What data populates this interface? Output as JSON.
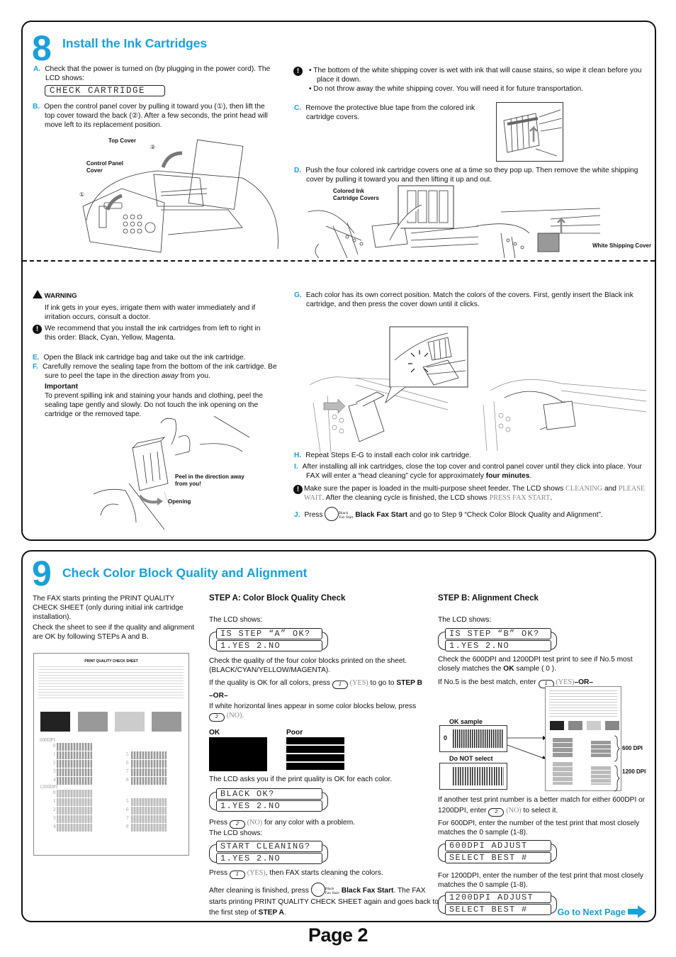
{
  "step8": {
    "number": "8",
    "title": "Install the Ink Cartridges",
    "a": {
      "letter": "A.",
      "text": "Check that the power is turned on (by plugging in the power cord). The LCD shows:",
      "lcd": "CHECK CARTRIDGE"
    },
    "b": {
      "letter": "B.",
      "text": "Open the control panel cover by pulling it toward you (①), then lift the top cover toward the back (②). After a few seconds, the print head will move left to its replacement position."
    },
    "fig_b_labels": {
      "top_cover": "Top Cover",
      "control_panel_cover": "Control Panel Cover",
      "marker1": "①",
      "marker2": "②"
    },
    "note_top": {
      "bullets": [
        "The bottom of the white shipping cover is wet with ink that will cause stains, so wipe it clean before you place it down.",
        "Do not throw away the white shipping cover. You will need it for future transportation."
      ]
    },
    "c": {
      "letter": "C.",
      "text": "Remove the protective blue tape from the colored ink cartridge covers."
    },
    "d": {
      "letter": "D.",
      "text": "Push the four colored ink cartridge covers one at a time so they pop up. Then remove the white shipping cover by pulling it toward you and then lifting it up and out."
    },
    "fig_d_labels": {
      "colored_covers": "Colored Ink Cartridge Covers",
      "white_cover": "White Shipping Cover"
    },
    "warning": {
      "title": "WARNING",
      "text": "If ink gets in your eyes, irrigate them with water immediately and if irritation occurs, consult a doctor."
    },
    "note_order": "We recommend that you install the ink cartridges from left to right in this order: Black, Cyan, Yellow, Magenta.",
    "e": {
      "letter": "E.",
      "text": "Open the Black ink cartridge bag and take out the ink cartridge."
    },
    "f": {
      "letter": "F.",
      "text_before": "Carefully remove the sealing tape from the bottom of the ink cartridge. Be sure to peel the tape in the direction ",
      "text_em": "away",
      "text_after": " from you."
    },
    "important": {
      "title": "Important",
      "text": "To prevent spilling ink and staining your hands and clothing, peel the sealing tape gently and slowly. Do not touch the ink opening on the cartridge or the removed tape."
    },
    "fig_f_labels": {
      "peel": "Peel in the direction away from you!",
      "opening": "Opening"
    },
    "g": {
      "letter": "G.",
      "text": "Each color has its own correct position. Match the colors of the covers. First, gently insert the Black ink cartridge, and then press the cover down until it clicks."
    },
    "h": {
      "letter": "H.",
      "text": "Repeat Steps E-G to install each color ink cartridge."
    },
    "i": {
      "letter": "I.",
      "text_before": "After installing all ink cartridges, close the top cover and control panel cover until they click into place. Your FAX will enter a “head cleaning” cycle for approximately ",
      "text_bold": "four minutes",
      "text_after": "."
    },
    "note_paper": {
      "t1": "Make sure the paper is loaded in the multi-purpose sheet feeder. The LCD shows ",
      "lcd1": "CLEANING",
      "t2": " and ",
      "lcd2": "PLEASE WAIT",
      "t3": ". After the cleaning cycle is finished, the LCD shows ",
      "lcd3": "PRESS FAX START",
      "t4": "."
    },
    "j": {
      "letter": "J.",
      "press": "Press",
      "key_label": "Black Fax Start",
      "bold": "Black Fax Start",
      "after": " and go to Step 9 “Check Color Block Quality and Alignment”."
    }
  },
  "step9": {
    "number": "9",
    "title": "Check Color Block Quality and Alignment",
    "intro1": "The FAX starts printing the PRINT QUALITY CHECK SHEET (only during initial ink cartridge installation).",
    "intro2": "Check the sheet to see if the quality and alignment are OK by following STEPs A and B.",
    "sheet": {
      "title": "PRINT QUALITY CHECK SHEET",
      "dpi600": "600DPI",
      "dpi1200": "1200DPI",
      "left_nums": [
        "0",
        "1",
        "2",
        "3",
        "4"
      ],
      "right_nums": [
        "5",
        "6",
        "7",
        "8"
      ]
    },
    "step_a": {
      "heading": "STEP A: Color Block Quality Check",
      "lcd_shows": "The LCD shows:",
      "lcd1": [
        "IS STEP “A” OK?",
        "1.YES 2.NO"
      ],
      "check_text": "Check the quality of the four color blocks printed on the sheet. (BLACK/CYAN/YELLOW/MAGENTA).",
      "if_ok_before": "If the quality is OK for all colors, press ",
      "key1": "1",
      "yes": "(YES)",
      "if_ok_after": " to go to ",
      "step_b_ref": "STEP B",
      "or": "–OR–",
      "if_lines": "If white horizontal lines appear in some color blocks below, press",
      "key2": "2",
      "no": "(NO).",
      "ok_label": "OK",
      "poor_label": "Poor",
      "asks": "The LCD asks you if the print quality is OK for each color.",
      "lcd2": [
        "BLACK OK?",
        "1.YES 2.NO"
      ],
      "press": "Press ",
      "no_any": "(NO)",
      "no_any_after": " for any color with a problem.",
      "lcd_shows2": "The LCD shows:",
      "lcd3": [
        "START CLEANING?",
        "1.YES 2.NO"
      ],
      "press_yes_after": "(YES)",
      "press_yes_tail": ", then FAX starts cleaning the colors.",
      "after_cleaning": "After cleaning is finished, press ",
      "key_label": "Black Fax Start",
      "bfs": "Black Fax Start",
      "tail1": ". The FAX starts printing PRINT QUALITY CHECK SHEET again and goes back to the first step of ",
      "step_a_ref": "STEP A",
      "tail2": "."
    },
    "step_b": {
      "heading": "STEP B: Alignment Check",
      "lcd_shows": "The LCD shows:",
      "lcd1": [
        "IS STEP “B” OK?",
        "1.YES 2.NO"
      ],
      "check_before": "Check the 600DPI and 1200DPI test print to see if No.5 most closely matches the ",
      "ok": "OK",
      "check_after": " sample ( 0 ).",
      "if_best_before": "If No.5 is the best match, enter ",
      "key1": "1",
      "yes": "(YES)",
      "or": "–OR–",
      "ok_sample": "OK sample",
      "ok_num": "0",
      "do_not": "Do NOT select",
      "dpi600": "600 DPI",
      "dpi1200": "1200 DPI",
      "another_before": "If another test print number is a better match for either 600DPI or 1200DPI, enter ",
      "key2": "2",
      "no": "(NO)",
      "another_after": " to select it.",
      "for600": "For 600DPI, enter the number of the test print that most closely matches the 0 sample (1-8).",
      "lcd2": [
        "600DPI ADJUST",
        "SELECT BEST #"
      ],
      "for1200": "For 1200DPI, enter the number of the test print that most closely matches the 0 sample (1-8).",
      "lcd3": [
        "1200DPI ADJUST",
        "SELECT BEST #"
      ]
    },
    "next_page": "Go to Next Page"
  },
  "footer": {
    "page": "Page 2"
  },
  "colors": {
    "accent": "#1aa0dc",
    "text": "#111111",
    "lcd_grey": "#888888"
  }
}
